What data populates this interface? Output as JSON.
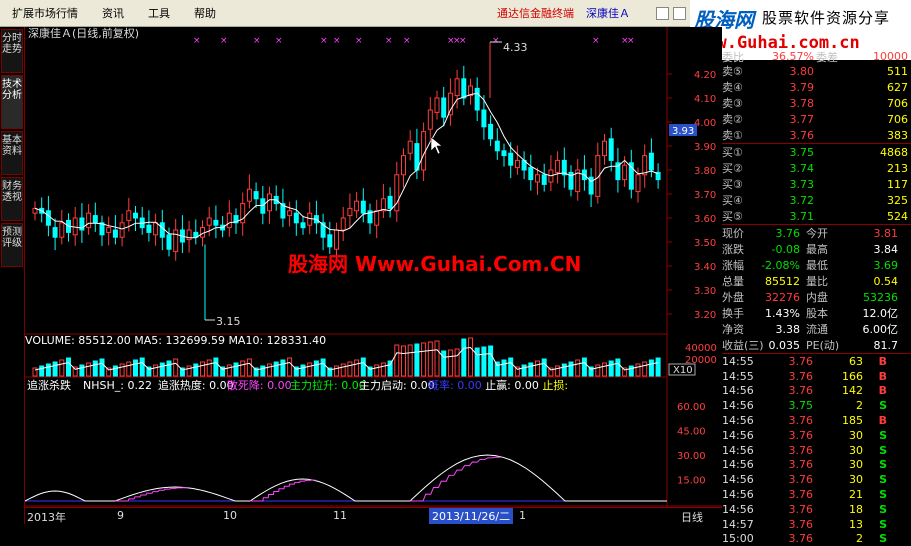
{
  "menu": {
    "items": [
      "扩展市场行情",
      "资讯",
      "工具",
      "帮助"
    ],
    "title_left": "通达信金融终端",
    "title_right": "深康佳Ａ"
  },
  "logo": {
    "cn": "股海网",
    "slogan": "股票软件资源分享",
    "url": "www.Guhai.com.cn"
  },
  "left_tabs": [
    "分时走势",
    "技术分析",
    "基本资料",
    "财务透视",
    "预测评级"
  ],
  "chart": {
    "header": "深康佳Ａ(日线,前复权)",
    "watermark": "股海网 Www.Guhai.Com.CN",
    "price_axis": [
      "4.20",
      "4.10",
      "4.00",
      "3.90",
      "3.80",
      "3.70",
      "3.60",
      "3.50",
      "3.40",
      "3.30",
      "3.20"
    ],
    "current_price": "3.93",
    "high_mark": "4.33",
    "low_mark": "3.15",
    "volume_label": "VOLUME: 85512.00  MA5: 132699.59  MA10: 128331.40",
    "volume_axis": [
      "40000",
      "20000"
    ],
    "volume_unit": "X10",
    "ind_label_name": "追涨杀跌",
    "ind_items": [
      {
        "t": "NHSH_: 0.22",
        "c": "#ffffff"
      },
      {
        "t": "追涨热度: 0.00",
        "c": "#ffffff"
      },
      {
        "t": "散死降: 0.00",
        "c": "#ff44ff"
      },
      {
        "t": "主力拉升: 0.00",
        "c": "#00ee00"
      },
      {
        "t": "主力启动: 0.00",
        "c": "#ffffff"
      },
      {
        "t": "概率: 0.00",
        "c": "#3a3aff"
      },
      {
        "t": "止赢: 0.00",
        "c": "#ffffff"
      },
      {
        "t": "止损:",
        "c": "#ffff00"
      }
    ],
    "ind_axis": [
      "60.00",
      "45.00",
      "30.00",
      "15.00"
    ],
    "dates": [
      "2013年",
      "9",
      "10",
      "11",
      "2013/11/26/二",
      "1"
    ],
    "period": "日线"
  },
  "quotes": {
    "weibi_label": "委比",
    "weibi": "36.57%",
    "weicha_label": "委差",
    "weicha": "10000",
    "sell": [
      {
        "l": "卖⑤",
        "p": "3.80",
        "v": "511"
      },
      {
        "l": "卖④",
        "p": "3.79",
        "v": "627"
      },
      {
        "l": "卖③",
        "p": "3.78",
        "v": "706"
      },
      {
        "l": "卖②",
        "p": "3.77",
        "v": "706"
      },
      {
        "l": "卖①",
        "p": "3.76",
        "v": "383"
      }
    ],
    "buy": [
      {
        "l": "买①",
        "p": "3.75",
        "v": "4868"
      },
      {
        "l": "买②",
        "p": "3.74",
        "v": "213"
      },
      {
        "l": "买③",
        "p": "3.73",
        "v": "117"
      },
      {
        "l": "买④",
        "p": "3.72",
        "v": "325"
      },
      {
        "l": "买⑤",
        "p": "3.71",
        "v": "524"
      }
    ],
    "stats": [
      {
        "l1": "现价",
        "v1": "3.76",
        "c1": "g",
        "l2": "今开",
        "v2": "3.81",
        "c2": "r"
      },
      {
        "l1": "涨跌",
        "v1": "-0.08",
        "c1": "g",
        "l2": "最高",
        "v2": "3.84",
        "c2": "w"
      },
      {
        "l1": "涨幅",
        "v1": "-2.08%",
        "c1": "g",
        "l2": "最低",
        "v2": "3.69",
        "c2": "g"
      },
      {
        "l1": "总量",
        "v1": "85512",
        "c1": "y",
        "l2": "量比",
        "v2": "0.54",
        "c2": "y"
      },
      {
        "l1": "外盘",
        "v1": "32276",
        "c1": "r",
        "l2": "内盘",
        "v2": "53236",
        "c2": "g"
      },
      {
        "l1": "换手",
        "v1": "1.43%",
        "c1": "w",
        "l2": "股本",
        "v2": "12.0亿",
        "c2": "w"
      },
      {
        "l1": "净资",
        "v1": "3.38",
        "c1": "w",
        "l2": "流通",
        "v2": "6.00亿",
        "c2": "w"
      },
      {
        "l1": "收益(三)",
        "v1": "0.035",
        "c1": "w",
        "l2": "PE(动)",
        "v2": "81.7",
        "c2": "w"
      }
    ],
    "trades": [
      {
        "t": "14:55",
        "p": "3.76",
        "v": "63",
        "bs": "B"
      },
      {
        "t": "14:55",
        "p": "3.76",
        "v": "166",
        "bs": "B"
      },
      {
        "t": "14:56",
        "p": "3.76",
        "v": "142",
        "bs": "B"
      },
      {
        "t": "14:56",
        "p": "3.75",
        "v": "2",
        "bs": "S"
      },
      {
        "t": "14:56",
        "p": "3.76",
        "v": "185",
        "bs": "B"
      },
      {
        "t": "14:56",
        "p": "3.76",
        "v": "30",
        "bs": "S"
      },
      {
        "t": "14:56",
        "p": "3.76",
        "v": "30",
        "bs": "S"
      },
      {
        "t": "14:56",
        "p": "3.76",
        "v": "30",
        "bs": "S"
      },
      {
        "t": "14:56",
        "p": "3.76",
        "v": "30",
        "bs": "S"
      },
      {
        "t": "14:56",
        "p": "3.76",
        "v": "21",
        "bs": "S"
      },
      {
        "t": "14:56",
        "p": "3.76",
        "v": "18",
        "bs": "S"
      },
      {
        "t": "14:57",
        "p": "3.76",
        "v": "13",
        "bs": "S"
      },
      {
        "t": "15:00",
        "p": "3.76",
        "v": "2",
        "bs": "S"
      }
    ]
  },
  "colors": {
    "up": "#ff3c3c",
    "down": "#00ffff",
    "ma": "#ffffff",
    "grid": "#8a0000",
    "accent": "#ffff00"
  }
}
